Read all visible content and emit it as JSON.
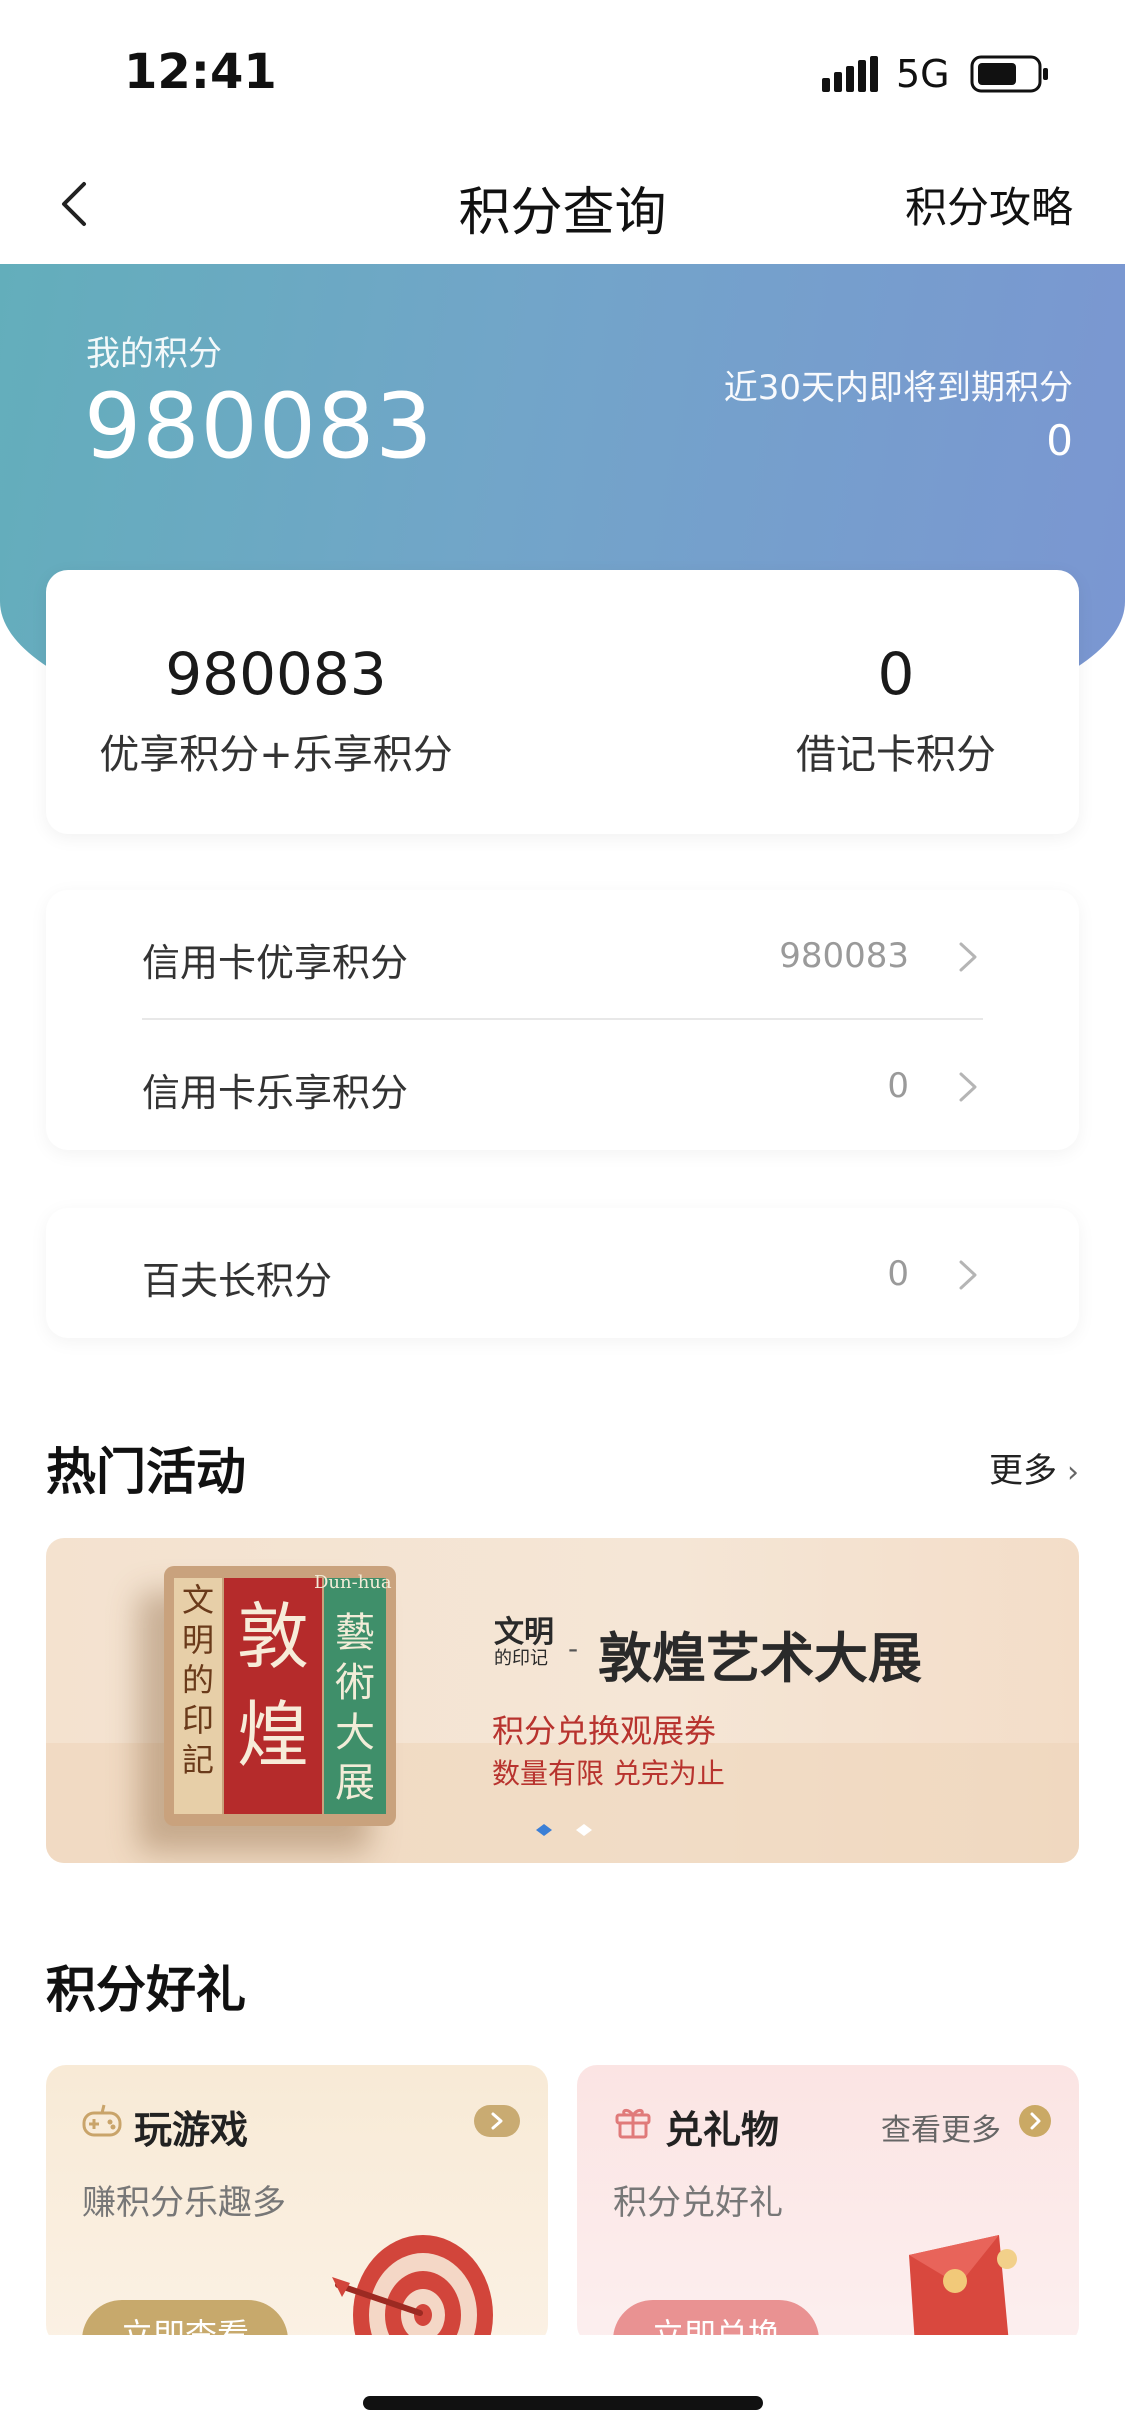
{
  "status_bar": {
    "time": "12:41",
    "network": "5G"
  },
  "nav": {
    "title": "积分查询",
    "action": "积分攻略"
  },
  "hero": {
    "label": "我的积分",
    "points": "980083",
    "expire_label": "近30天内即将到期积分",
    "expire_value": "0"
  },
  "summary": {
    "left": {
      "value": "980083",
      "label": "优享积分+乐享积分"
    },
    "right": {
      "value": "0",
      "label": "借记卡积分"
    }
  },
  "credit_list": [
    {
      "label": "信用卡优享积分",
      "value": "980083"
    },
    {
      "label": "信用卡乐享积分",
      "value": "0"
    }
  ],
  "centurion": {
    "label": "百夫长积分",
    "value": "0"
  },
  "hot": {
    "title": "热门活动",
    "more": "更多"
  },
  "banner": {
    "book_left": "文明的印記",
    "book_red": "敦煌",
    "book_green": "藝術大展",
    "book_en": "Dun-hua",
    "brand": "文明",
    "brand_small": "的印记",
    "title": "敦煌艺术大展",
    "sub1": "积分兑换观展券",
    "sub2": "数量有限 兑完为止",
    "active_slide": 1,
    "slide_count": 2
  },
  "gifts": {
    "title": "积分好礼",
    "game": {
      "title": "玩游戏",
      "sub": "赚积分乐趣多",
      "button": "立即查看"
    },
    "gift": {
      "title": "兑礼物",
      "sub": "积分兑好礼",
      "more": "查看更多",
      "button": "立即兑换"
    }
  },
  "colors": {
    "hero_start": "#63aebb",
    "hero_end": "#7b96d2",
    "banner_red": "#b8332e",
    "gold": "#c7a96c"
  }
}
